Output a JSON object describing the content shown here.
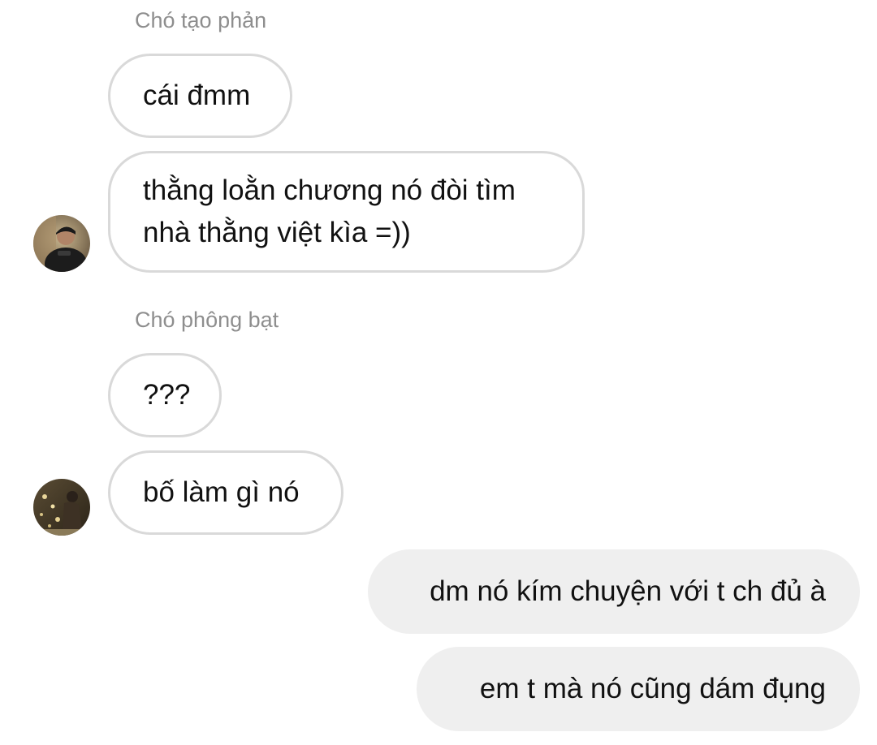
{
  "messages": [
    {
      "sender": "Chó tạo phản"
    },
    {
      "text": "cái đmm"
    },
    {
      "lines": [
        "thằng loằn chương nó đòi tìm",
        "nhà thằng việt kìa =))"
      ]
    },
    {
      "sender": "Chó phông bạt"
    },
    {
      "text": "???"
    },
    {
      "text": "bố làm gì nó"
    },
    {
      "text": "dm nó kím chuyện với t ch đủ à"
    },
    {
      "text": "em t mà nó cũng dám đụng"
    }
  ],
  "colors": {
    "incoming_bubble_border": "#d9d9d9",
    "outgoing_bubble_bg": "#efefef",
    "sender_name": "#8e8e8e",
    "text": "#111111"
  },
  "icons": [
    "avatar-1",
    "avatar-2"
  ]
}
